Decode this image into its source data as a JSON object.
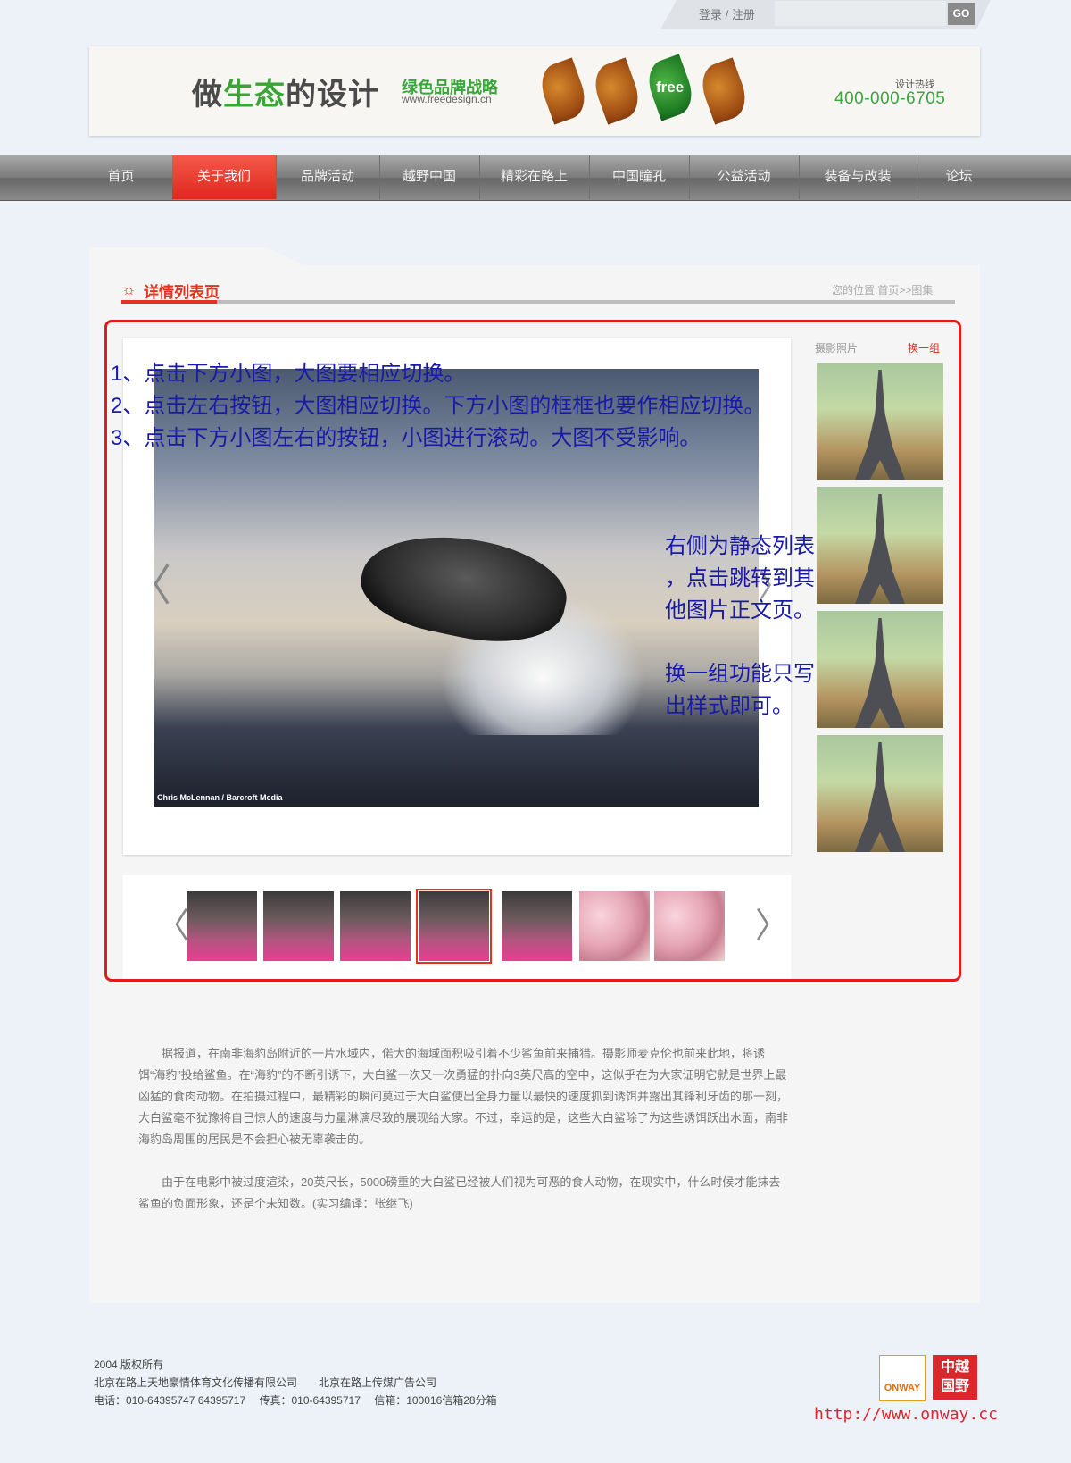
{
  "topbar": {
    "login_register": "登录 / 注册",
    "search_placeholder": "",
    "go_label": "GO"
  },
  "header": {
    "slogan_part1": "做",
    "slogan_part2": "生态",
    "slogan_part3": "的设计",
    "brand_cn": "绿色品牌战略",
    "brand_url": "www.freedesign.cn",
    "leaf_text": "free",
    "hotline_label": "设计热线",
    "hotline_number": "400-000-6705"
  },
  "nav": [
    "首页",
    "关于我们",
    "品牌活动",
    "越野中国",
    "精彩在路上",
    "中国瞳孔",
    "公益活动",
    "装备与改装",
    "论坛"
  ],
  "nav_active_index": 1,
  "page": {
    "title": "详情列表页",
    "breadcrumb": "您的位置:首页>>图集"
  },
  "viewer": {
    "photo_credit": "Chris McLennan / Barcroft Media",
    "prev_arrow": "〈",
    "next_arrow": "〉"
  },
  "annotations": {
    "line1": "1、点击下方小图，大图要相应切换。",
    "line2": "2、点击左右按钮，大图相应切换。下方小图的框框也要作相应切换。",
    "line3": "3、点击下方小图左右的按钮，小图进行滚动。大图不受影响。",
    "right1": "右侧为静态列表",
    "right2": "，点击跳转到其",
    "right3": "他图片正文页。",
    "right4": "换一组功能只写",
    "right5": "出样式即可。"
  },
  "sidebar": {
    "label": "摄影照片",
    "change": "换一组"
  },
  "thumbs": {
    "selected_index": 3,
    "count": 7
  },
  "article": {
    "p1": "据报道，在南非海豹岛附近的一片水域内，偌大的海域面积吸引着不少鲨鱼前来捕猎。摄影师麦克伦也前来此地，将诱饵“海豹”投给鲨鱼。在“海豹”的不断引诱下，大白鲨一次又一次勇猛的扑向3英尺高的空中，这似乎在为大家证明它就是世界上最凶猛的食肉动物。在拍摄过程中，最精彩的瞬间莫过于大白鲨使出全身力量以最快的速度抓到诱饵并露出其锋利牙齿的那一刻，大白鲨毫不犹豫将自己惊人的速度与力量淋漓尽致的展现给大家。不过，幸运的是，这些大白鲨除了为这些诱饵跃出水面，南非海豹岛周围的居民是不会担心被无辜袭击的。",
    "p2": "由于在电影中被过度渲染，20英尺长，5000磅重的大白鲨已经被人们视为可恶的食人动物，在现实中，什么时候才能抹去鲨鱼的负面形象，还是个未知数。(实习编译：张继飞)"
  },
  "footer": {
    "copyright": "2004 版权所有",
    "companies": "北京在路上天地豪情体育文化传播有限公司　　北京在路上传媒广告公司",
    "contact": "电话：010-64395747 64395717　 传真：010-64395717　 信箱：100016信箱28分箱",
    "logo1": "ONWAY",
    "logo2_line1": "中越",
    "logo2_line2": "国野",
    "url": "http://www.onway.cc"
  },
  "colors": {
    "accent_red": "#e3321f",
    "brand_green": "#3aa53a",
    "annotation_blue": "#1a1aa8",
    "frame_red": "#e21a1a"
  }
}
